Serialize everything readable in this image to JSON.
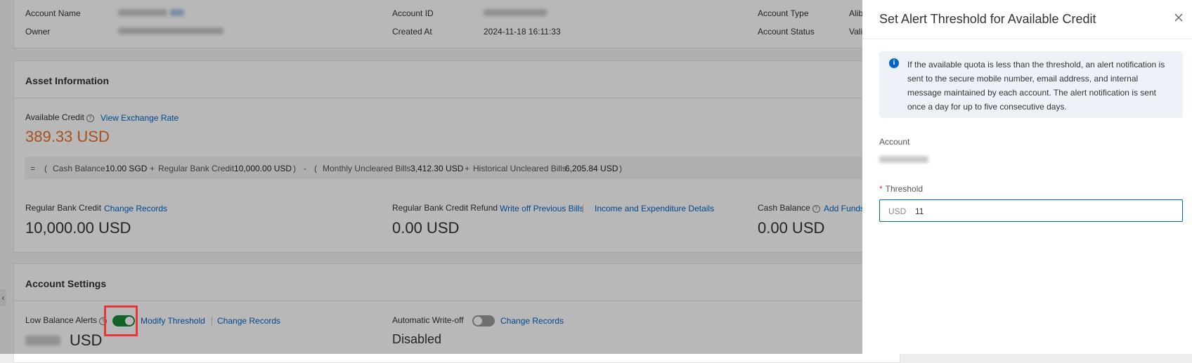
{
  "account": {
    "name_label": "Account Name",
    "owner_label": "Owner",
    "id_label": "Account ID",
    "created_label": "Created At",
    "created_value": "2024-11-18 16:11:33",
    "type_label": "Account Type",
    "type_value_partial": "Alib",
    "status_label": "Account Status",
    "status_value_partial": "Vali"
  },
  "assets": {
    "title": "Asset Information",
    "available_credit_label": "Available Credit",
    "view_exchange_rate": "View Exchange Rate",
    "available_credit_value": "389.33 USD",
    "formula": {
      "eq": "=",
      "open1": "(",
      "cash_balance_label": "Cash Balance",
      "cash_balance_value": "10.00 SGD",
      "plus1": "+",
      "regular_bank_credit_label": "Regular Bank Credit",
      "regular_bank_credit_value": "10,000.00 USD",
      "close1": ")",
      "minus": "-",
      "open2": "(",
      "monthly_uncleared_label": "Monthly Uncleared Bills",
      "monthly_uncleared_value": "3,412.30 USD",
      "plus2": "+",
      "historical_uncleared_label": "Historical Uncleared Bills",
      "historical_uncleared_value": "6,205.84 USD",
      "close2": ")"
    },
    "regular_bank_credit_label": "Regular Bank Credit",
    "change_records": "Change Records",
    "regular_bank_credit_value": "10,000.00 USD",
    "refund_label": "Regular Bank Credit Refund",
    "write_off_previous_bills": "Write off Previous Bills",
    "income_expenditure_details": "Income and Expenditure Details",
    "refund_value": "0.00 USD",
    "cash_balance_label": "Cash Balance",
    "add_funds_partial": "Add Funds",
    "cash_balance_value": "0.00 USD"
  },
  "settings": {
    "title": "Account Settings",
    "low_balance_label": "Low Balance Alerts",
    "low_balance_on": true,
    "modify_threshold": "Modify Threshold",
    "change_records": "Change Records",
    "low_balance_unit": "USD",
    "write_off_label": "Automatic Write-off",
    "write_off_on": false,
    "write_off_change_records": "Change Records",
    "write_off_value": "Disabled"
  },
  "drawer": {
    "title": "Set Alert Threshold for Available Credit",
    "alert_text": "If the available quota is less than the threshold, an alert notification is sent to the secure mobile number, email address, and internal message maintained by each account. The alert notification is sent once a day for up to five consecutive days.",
    "account_label": "Account",
    "threshold_required_mark": "*",
    "threshold_label": "Threshold",
    "currency_prefix": "USD",
    "threshold_value": "11"
  },
  "colors": {
    "accent": "#0064c8",
    "credit_orange": "#e8712a",
    "toggle_on": "#1a8a3b",
    "highlight_red": "#e8363b"
  },
  "icons": {
    "help": "question-circle-icon",
    "info": "info-circle-icon",
    "close": "close-icon",
    "collapse": "chevron-left-icon"
  }
}
